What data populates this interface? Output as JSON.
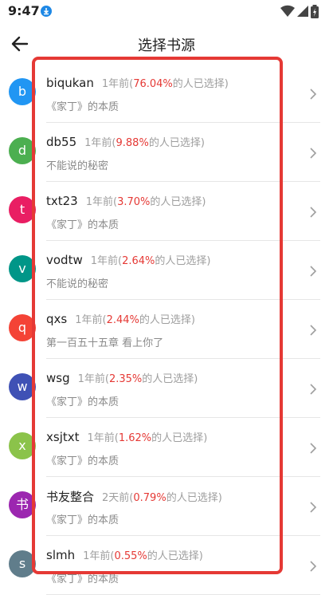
{
  "status": {
    "time": "9:47"
  },
  "appbar": {
    "title": "选择书源"
  },
  "text": {
    "open": "(",
    "close": ")"
  },
  "sources": [
    {
      "avatar": "b",
      "color": "#2196f3",
      "name": "biqukan",
      "time": "1年前",
      "percent": "76.04%",
      "suffix": "的人已选择",
      "chapter": "《家丁》的本质"
    },
    {
      "avatar": "d",
      "color": "#4caf50",
      "name": "db55",
      "time": "1年前",
      "percent": "9.88%",
      "suffix": "的人已选择",
      "chapter": "不能说的秘密"
    },
    {
      "avatar": "t",
      "color": "#e91e63",
      "name": "txt23",
      "time": "1年前",
      "percent": "3.70%",
      "suffix": "的人已选择",
      "chapter": "《家丁》的本质"
    },
    {
      "avatar": "v",
      "color": "#009688",
      "name": "vodtw",
      "time": "1年前",
      "percent": "2.64%",
      "suffix": "的人已选择",
      "chapter": "不能说的秘密"
    },
    {
      "avatar": "q",
      "color": "#f44336",
      "name": "qxs",
      "time": "1年前",
      "percent": "2.44%",
      "suffix": "的人已选择",
      "chapter": "第一百五十五章 看上你了"
    },
    {
      "avatar": "w",
      "color": "#3f51b5",
      "name": "wsg",
      "time": "1年前",
      "percent": "2.35%",
      "suffix": "的人已选择",
      "chapter": "《家丁》的本质"
    },
    {
      "avatar": "x",
      "color": "#8bc34a",
      "name": "xsjtxt",
      "time": "1年前",
      "percent": "1.62%",
      "suffix": "的人已选择",
      "chapter": "《家丁》的本质"
    },
    {
      "avatar": "书",
      "color": "#9c27b0",
      "name": "书友整合",
      "time": "2天前",
      "percent": "0.79%",
      "suffix": "的人已选择",
      "chapter": "《家丁》的本质"
    },
    {
      "avatar": "s",
      "color": "#607d8b",
      "name": "slmh",
      "time": "1年前",
      "percent": "0.55%",
      "suffix": "的人已选择",
      "chapter": "《家丁》的本质"
    }
  ]
}
